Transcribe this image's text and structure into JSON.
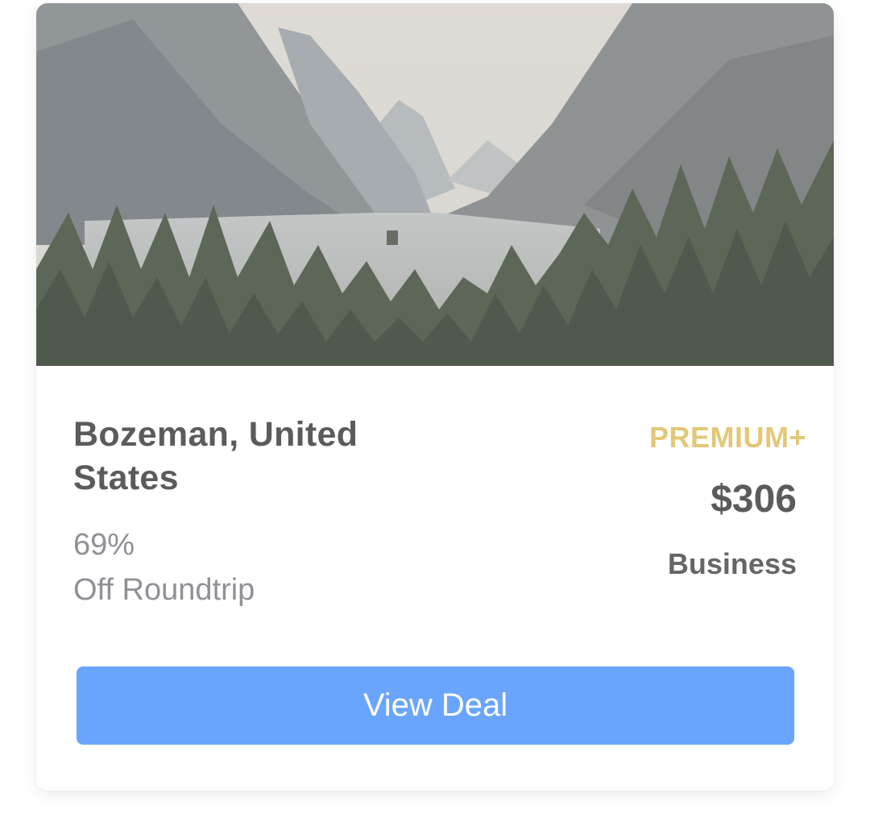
{
  "deal": {
    "image": {
      "subject": "misty mountain lake with pine forest"
    },
    "destination": "Bozeman, United States",
    "discount_percent": "69%",
    "discount_label": "Off Roundtrip",
    "tier": "PREMIUM+",
    "price": "$306",
    "cabin": "Business",
    "cta_label": "View Deal"
  },
  "colors": {
    "accent": "#6aa5fd",
    "tier": "#e2c878",
    "title": "#5b5b5b",
    "muted": "#8f9196"
  }
}
